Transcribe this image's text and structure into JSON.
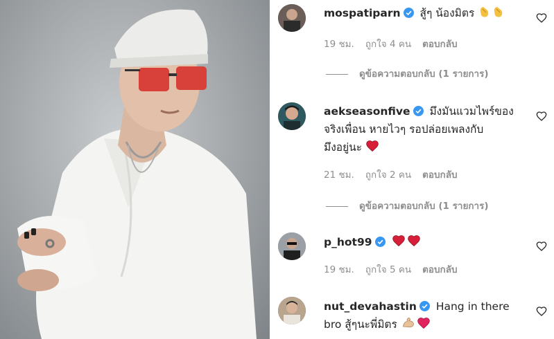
{
  "comments": [
    {
      "username": "mospatiparn",
      "text": "สู้ๆ น้องมิตร",
      "emojis": [
        "clap-icon",
        "clap-icon"
      ],
      "time": "19 ชม.",
      "likes": "ถูกใจ 4 คน",
      "reply_label": "ตอบกลับ",
      "view_replies": "ดูข้อความตอบกลับ (1 รายการ)"
    },
    {
      "username": "aekseasonfive",
      "text_line1": "มึงมันแวมไพร์ของ",
      "text_line2": "จริงเพื่อน หายไวๆ รอปล่อยเพลงกับ",
      "text_line3": "มึงอยู่นะ",
      "emojis": [
        "red-heart-icon"
      ],
      "time": "21 ชม.",
      "likes": "ถูกใจ 2 คน",
      "reply_label": "ตอบกลับ",
      "view_replies": "ดูข้อความตอบกลับ (1 รายการ)"
    },
    {
      "username": "p_hot99",
      "text": "",
      "emojis": [
        "red-heart-icon",
        "red-heart-icon"
      ],
      "time": "19 ชม.",
      "likes": "ถูกใจ 5 คน",
      "reply_label": "ตอบกลับ"
    },
    {
      "username": "nut_devahastin",
      "text_line1": "Hang in there",
      "text_line2": "bro สู้ๆนะพี่มิตร",
      "emojis": [
        "flexed-biceps-icon",
        "pink-heart-icon"
      ]
    }
  ],
  "colors": {
    "verified": "#3897f0",
    "meta": "#8e8e8e",
    "heart_emoji": "#e0245e"
  }
}
